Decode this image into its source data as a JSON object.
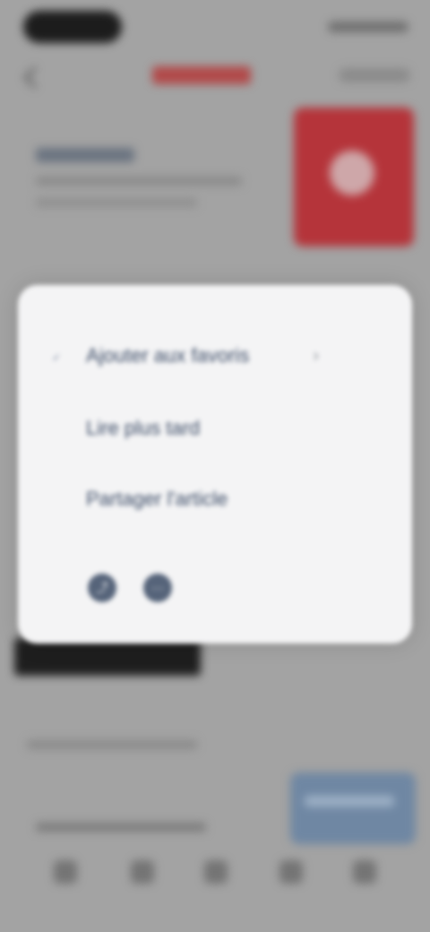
{
  "options_sheet": {
    "options": [
      {
        "label": "Ajouter aux favoris",
        "selected": true
      },
      {
        "label": "Lire plus tard"
      },
      {
        "label": "Partager l'article"
      }
    ],
    "selected_check": "✓",
    "chevron": "›",
    "action_icons": [
      "share-icon",
      "more-icon"
    ],
    "action_glyphs": [
      "⤴",
      "⋯"
    ]
  },
  "colors": {
    "brand_red": "#b5343a",
    "accent_blue": "#6f87a3",
    "sheet_background": "#f4f4f5",
    "label_text": "#3b4b66"
  },
  "icons": {
    "back": "back-arrow-icon",
    "tabs": [
      "home-icon",
      "search-icon",
      "bookmark-icon",
      "notifications-icon",
      "profile-icon"
    ]
  }
}
